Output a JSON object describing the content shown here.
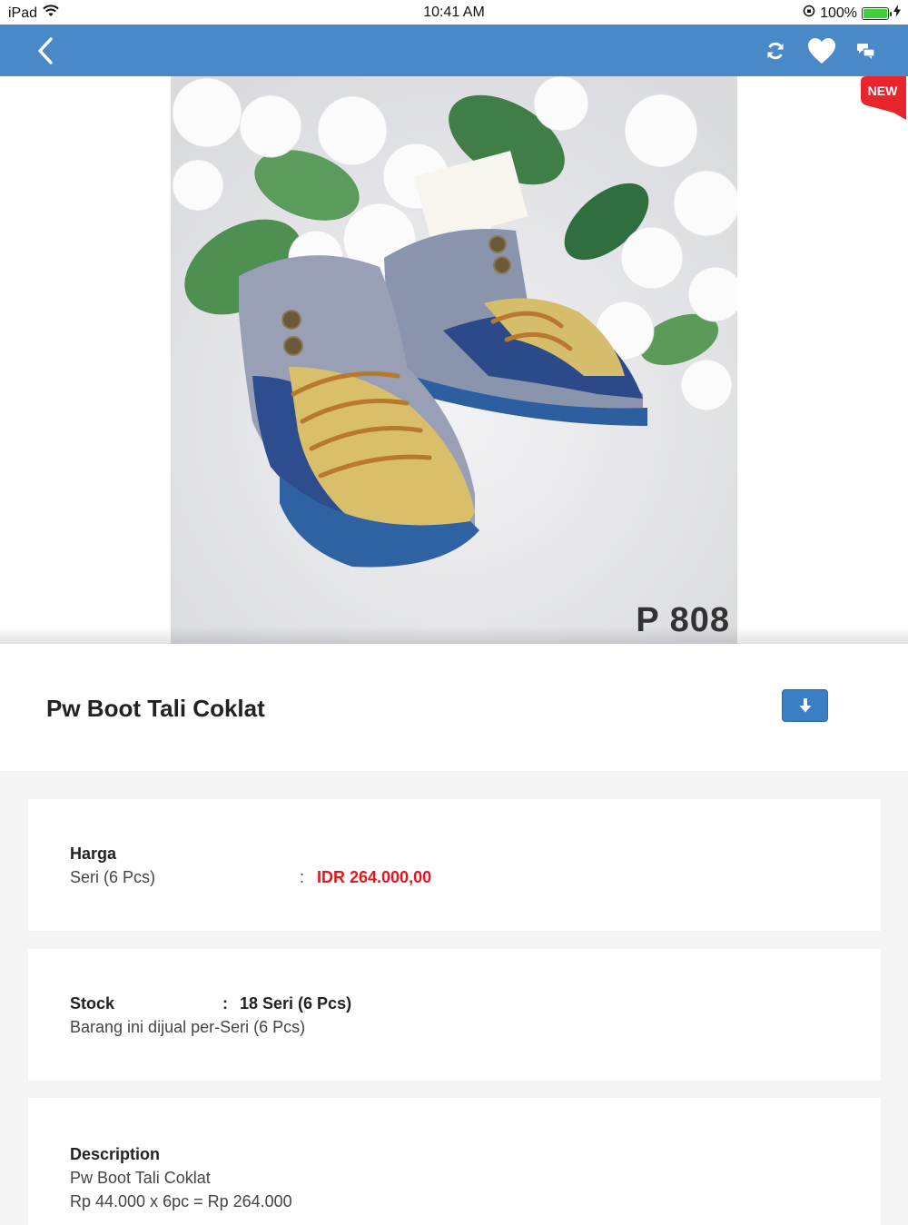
{
  "status_bar": {
    "device": "iPad",
    "time": "10:41 AM",
    "battery": "100%"
  },
  "nav": {
    "icons": [
      "back-chevron-icon",
      "refresh-icon",
      "heart-icon",
      "chat-icon"
    ]
  },
  "hero": {
    "code_text": "P 808",
    "badge": "NEW"
  },
  "product": {
    "title": "Pw Boot Tali Coklat"
  },
  "price": {
    "label": "Harga",
    "unit": "Seri (6 Pcs)",
    "colon": ":",
    "value": "IDR 264.000,00"
  },
  "stock": {
    "label": "Stock",
    "colon": ":",
    "value": "18 Seri (6 Pcs)",
    "note": "Barang ini dijual per-Seri (6 Pcs)"
  },
  "description": {
    "label": "Description",
    "line1": "Pw Boot Tali Coklat",
    "line2": "Rp 44.000 x 6pc = Rp 264.000"
  },
  "colors": {
    "nav_bg": "#4a89c8",
    "price_red": "#e8141e",
    "button_blue": "#3a7fc4",
    "badge_red": "#e8242c"
  }
}
